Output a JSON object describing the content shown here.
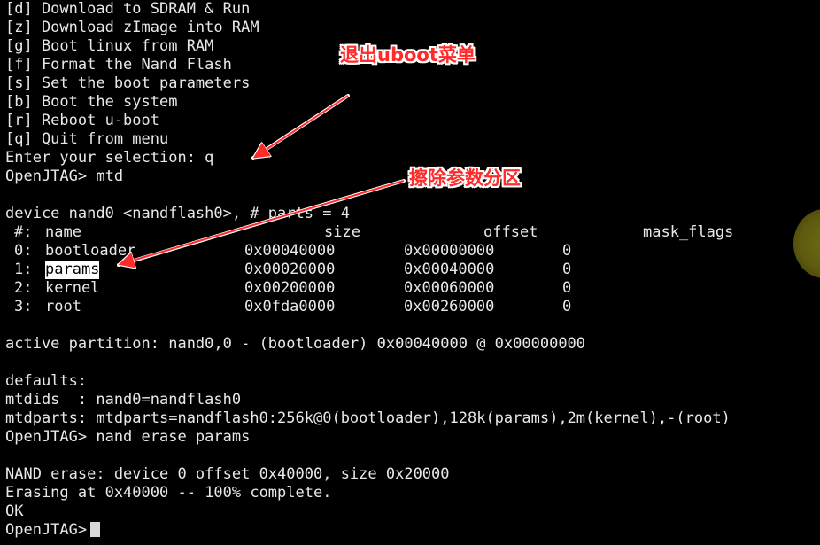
{
  "terminal": {
    "menu": [
      "[d] Download to SDRAM & Run",
      "[z] Download zImage into RAM",
      "[g] Boot linux from RAM",
      "[f] Format the Nand Flash",
      "[s] Set the boot parameters",
      "[b] Boot the system",
      "[r] Reboot u-boot",
      "[q] Quit from menu"
    ],
    "selection_line": "Enter your selection: q",
    "cmd_mtd": "OpenJTAG> mtd",
    "device_line": "device nand0 <nandflash0>, # parts = 4",
    "table": {
      "headers": {
        "num": "#:",
        "name": "name",
        "size": "size",
        "offset": "offset",
        "mask": "mask_flags"
      },
      "rows": [
        {
          "num": "0:",
          "name": "bootloader",
          "size": "0x00040000",
          "offset": "0x00000000",
          "mask": "0"
        },
        {
          "num": "1:",
          "name": "params",
          "size": "0x00020000",
          "offset": "0x00040000",
          "mask": "0"
        },
        {
          "num": "2:",
          "name": "kernel",
          "size": "0x00200000",
          "offset": "0x00060000",
          "mask": "0"
        },
        {
          "num": "3:",
          "name": "root",
          "size": "0x0fda0000",
          "offset": "0x00260000",
          "mask": "0"
        }
      ]
    },
    "active_partition": "active partition: nand0,0 - (bootloader) 0x00040000 @ 0x00000000",
    "defaults_label": "defaults:",
    "mtdids": "mtdids  : nand0=nandflash0",
    "mtdparts": "mtdparts: mtdparts=nandflash0:256k@0(bootloader),128k(params),2m(kernel),-(root)",
    "cmd_erase": "OpenJTAG> nand erase params",
    "erase_info": "NAND erase: device 0 offset 0x40000, size 0x20000",
    "erase_progress": "Erasing at 0x40000 -- 100% complete.",
    "ok": "OK",
    "prompt": "OpenJTAG>"
  },
  "annotations": {
    "quit_uboot": "退出uboot菜单",
    "erase_params": "擦除参数分区",
    "color": "#ff2a2a"
  },
  "colors": {
    "background": "#000000",
    "text": "#e8e8e8",
    "highlight_bg": "#ffffff"
  }
}
